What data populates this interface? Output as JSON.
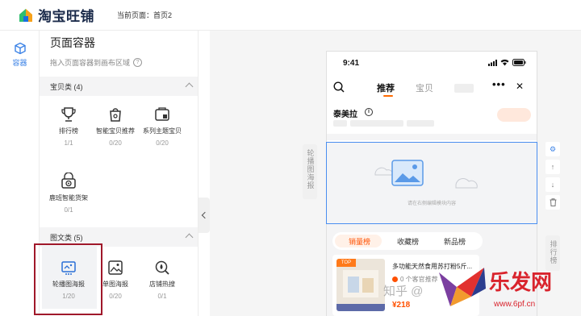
{
  "header": {
    "logo_text": "淘宝旺铺",
    "current_page": "当前页面：首页2"
  },
  "rail": {
    "container_label": "容器"
  },
  "panel": {
    "title": "页面容器",
    "hint": "拖入页面容器到画布区域",
    "categories": [
      {
        "label": "宝贝类 (4)"
      },
      {
        "label": "图文类 (5)"
      }
    ],
    "product_components": [
      {
        "name": "排行榜",
        "count": "1/1",
        "icon": "trophy-icon"
      },
      {
        "name": "智能宝贝推荐",
        "count": "0/20",
        "icon": "smart-bag-icon"
      },
      {
        "name": "系列主题宝贝",
        "count": "0/20",
        "icon": "theme-box-icon"
      },
      {
        "name": "鹿班智能货架",
        "count": "0/1",
        "icon": "smart-shelf-icon"
      }
    ],
    "media_components": [
      {
        "name": "轮播图海报",
        "count": "1/20",
        "icon": "carousel-icon"
      },
      {
        "name": "单图海报",
        "count": "0/20",
        "icon": "image-poster-icon"
      },
      {
        "name": "店铺热搜",
        "count": "0/1",
        "icon": "hot-search-icon"
      }
    ]
  },
  "canvas": {
    "left_tab": "轮播图海报",
    "right_tab": "排行榜",
    "phone": {
      "time": "9:41",
      "tab_active": "推荐",
      "tab_other": "宝贝",
      "shop_name": "泰美拉",
      "info_glyph": "i",
      "drop_caption": "请在右侧编辑模块内容",
      "rank_tabs": [
        "销量榜",
        "收藏榜",
        "新品榜"
      ],
      "product": {
        "title": "多功能天然食用苏打粉5斤...",
        "stat": "0 个客官推荐",
        "price": "¥218"
      }
    },
    "tools": [
      "gear-icon",
      "arrow-up-icon",
      "arrow-down-icon",
      "trash-icon"
    ]
  },
  "watermark": {
    "zhihu": "知乎 @",
    "brand": "乐发网",
    "url": "www.6pf.cn"
  },
  "colors": {
    "accent": "#3b82e6",
    "orange": "#ff5000",
    "highlight_border": "#a0182a"
  }
}
